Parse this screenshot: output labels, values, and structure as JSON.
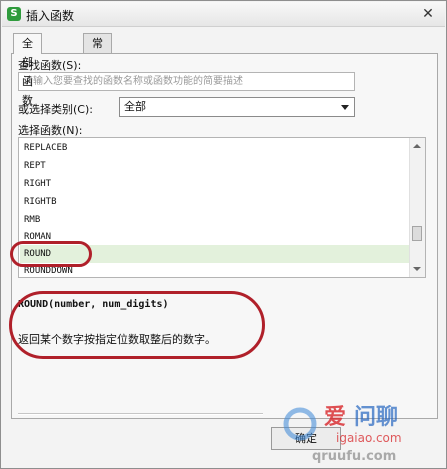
{
  "window": {
    "app_icon": "S",
    "title": "插入函数",
    "close_icon": "close-icon"
  },
  "tabs": [
    {
      "label": "全部函数",
      "active": true
    },
    {
      "label": "常用公式",
      "active": false
    }
  ],
  "search": {
    "label": "查找函数(S):",
    "placeholder": "请输入您要查找的函数名称或函数功能的简要描述"
  },
  "category": {
    "label": "或选择类别(C):",
    "value": "全部"
  },
  "function_list": {
    "label": "选择函数(N):",
    "items": [
      {
        "name": "REPLACEB",
        "selected": false
      },
      {
        "name": "REPT",
        "selected": false
      },
      {
        "name": "RIGHT",
        "selected": false
      },
      {
        "name": "RIGHTB",
        "selected": false
      },
      {
        "name": "RMB",
        "selected": false
      },
      {
        "name": "ROMAN",
        "selected": false
      },
      {
        "name": "ROUND",
        "selected": true
      },
      {
        "name": "ROUNDDOWN",
        "selected": false
      }
    ]
  },
  "details": {
    "signature": "ROUND(number, num_digits)",
    "description": "返回某个数字按指定位数取整后的数字。"
  },
  "buttons": {
    "ok": "确定"
  },
  "watermark": {
    "line1": "爱",
    "line2": "问聊",
    "line3": "igaiao.com",
    "line4": "qruufu.com"
  },
  "colors": {
    "highlight_oval": "#b0202a",
    "selected_row": "#e3f1dc",
    "app_icon": "#2f9b3d"
  }
}
